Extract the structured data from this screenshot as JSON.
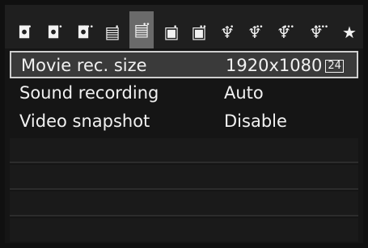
{
  "tabs": [
    {
      "id": "shoot1",
      "glyph": "◘",
      "dots": "•"
    },
    {
      "id": "shoot2",
      "glyph": "◘",
      "dots": "••"
    },
    {
      "id": "shoot3",
      "glyph": "◘",
      "dots": "•••"
    },
    {
      "id": "shoot-movie1",
      "glyph": "▤",
      "dots": "•"
    },
    {
      "id": "shoot-movie2",
      "glyph": "▤",
      "dots": "••"
    },
    {
      "id": "playback1",
      "glyph": "▣",
      "dots": "•"
    },
    {
      "id": "playback2",
      "glyph": "▣",
      "dots": "••"
    },
    {
      "id": "setup1",
      "glyph": "♆",
      "dots": "•"
    },
    {
      "id": "setup2",
      "glyph": "♆",
      "dots": "••"
    },
    {
      "id": "setup3",
      "glyph": "♆",
      "dots": "•••"
    },
    {
      "id": "setup4",
      "glyph": "♆",
      "dots": "••••"
    },
    {
      "id": "mymenu",
      "glyph": "★",
      "dots": ""
    }
  ],
  "active_tab_index": 4,
  "menu": {
    "items": [
      {
        "label": "Movie rec. size",
        "value": "1920x1080",
        "badge": "24"
      },
      {
        "label": "Sound recording",
        "value": "Auto",
        "badge": ""
      },
      {
        "label": "Video snapshot",
        "value": "Disable",
        "badge": ""
      }
    ],
    "selected_index": 0
  }
}
